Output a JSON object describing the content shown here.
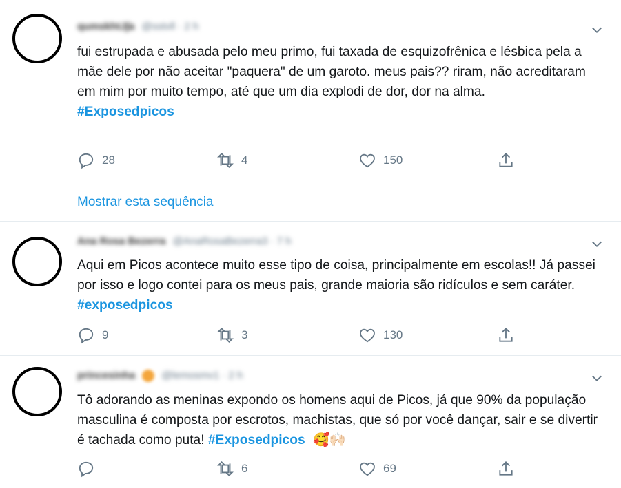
{
  "tweets": [
    {
      "name": "qumskhtJ∫a",
      "handle": "@sstvll · 2 h",
      "text": "fui estrupada e abusada pelo meu primo, fui taxada de  esquizofrênica e lésbica pela a mãe dele por não  aceitar \"paquera\" de um garoto. meus pais?? riram, não  acreditaram em mim por muito tempo, até que um dia explodi de dor, dor na alma.",
      "hashtag": "#Exposedpicos",
      "replies": "28",
      "retweets": "4",
      "likes": "150",
      "show_thread": "Mostrar esta sequência"
    },
    {
      "name": "Ana Rosa Bezerra",
      "handle": "@AnaRosaBezerra3 · 7 h",
      "text": "Aqui em Picos acontece muito esse tipo de coisa, principalmente em escolas!! Já passei por isso e logo contei para os meus pais, grande maioria são ridículos e sem caráter.",
      "hashtag": "#exposedpicos",
      "replies": "9",
      "retweets": "3",
      "likes": "130"
    },
    {
      "name": "princesinha",
      "handle": "@lemosmv1 · 2 h",
      "text": "Tô adorando as meninas expondo os homens aqui de Picos, já que 90% da população masculina é composta por escrotos, machistas, que só por você dançar, sair e se divertir é tachada como puta!",
      "hashtag": "#Exposedpicos",
      "emojis": "🥰🙌🏻",
      "replies": "",
      "retweets": "6",
      "likes": "69"
    }
  ],
  "icons": [
    "reply-icon",
    "retweet-icon",
    "like-icon",
    "share-icon",
    "chevron-down-icon"
  ],
  "colors": {
    "link": "#1b95e0",
    "muted": "#657786",
    "divider": "#e6ecf0"
  }
}
